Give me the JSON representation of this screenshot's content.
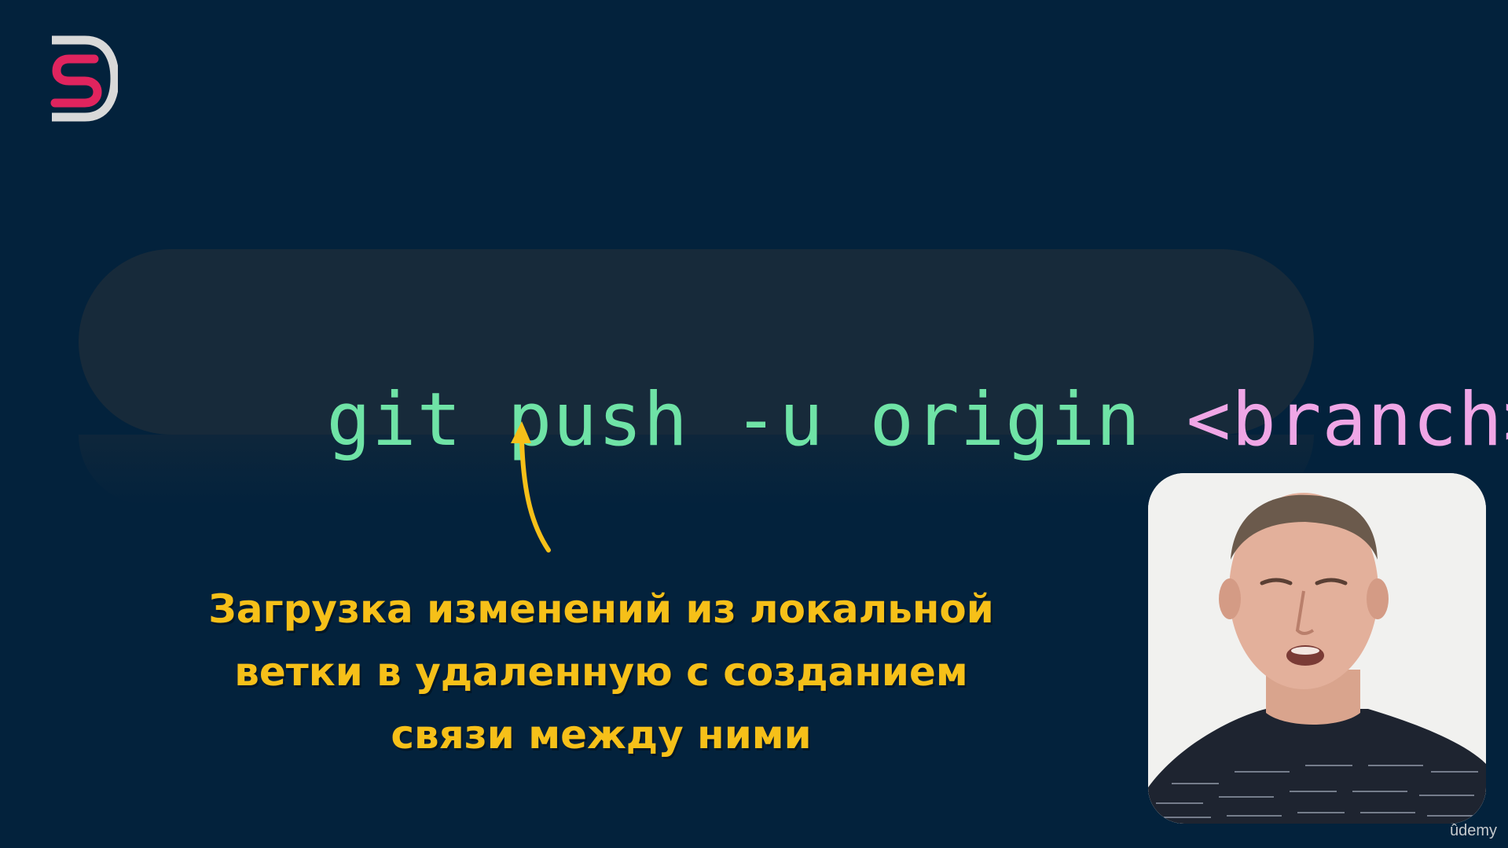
{
  "colors": {
    "background": "#03223c",
    "command": "#6fe3a6",
    "argument": "#f0a6e6",
    "caption": "#f6c019",
    "logo_outline": "#d9d9d9",
    "logo_accent": "#e0245e"
  },
  "logo": {
    "icon": "ds-logo-icon"
  },
  "command": {
    "main": "git push -u origin ",
    "argument": "<branch>"
  },
  "caption": {
    "lines": [
      "Загрузка изменений из локальной",
      "ветки в удаленную с созданием",
      "связи между ними"
    ]
  },
  "presenter": {
    "icon": "presenter-video"
  },
  "watermark": {
    "text": "ûdemy"
  }
}
